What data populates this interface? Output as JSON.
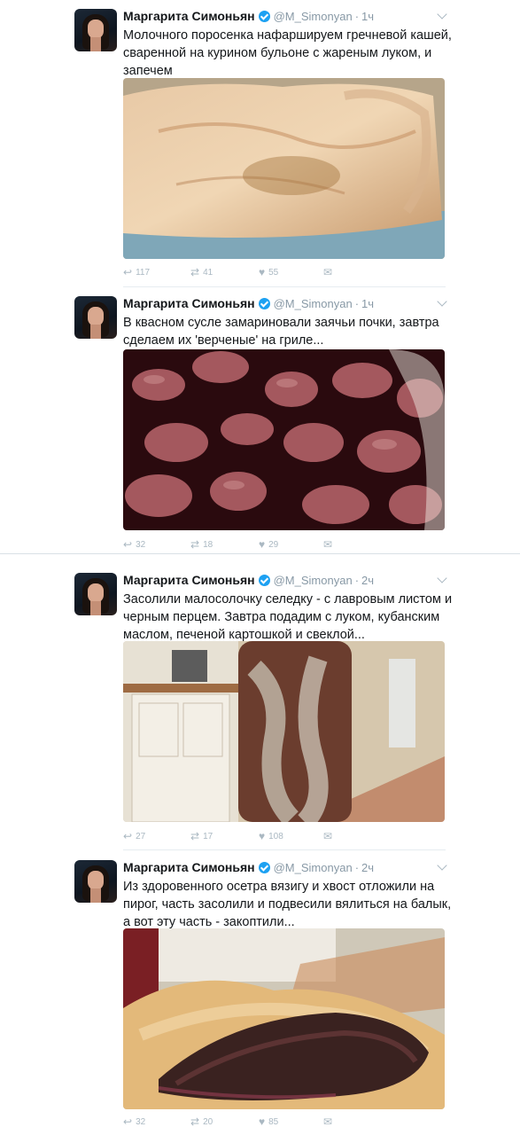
{
  "author": {
    "name": "Маргарита Симоньян",
    "handle": "@M_Simonyan"
  },
  "tweets": [
    {
      "time": "1ч",
      "text": "Молочного поросенка нафаршируем гречневой кашей, сваренной на курином бульоне с жареным луком, и запечем",
      "replies": "117",
      "retweets": "41",
      "likes": "55",
      "media": "roast-piglet-photo"
    },
    {
      "time": "1ч",
      "text": "В квасном сусле замариновали заячьи почки, завтра сделаем их 'верченые' на гриле...",
      "replies": "32",
      "retweets": "18",
      "likes": "29",
      "media": "marinated-kidneys-photo"
    },
    {
      "time": "2ч",
      "text": "Засолили малосолочку селедку - с лавровым листом и черным перцем. Завтра подадим с луком, кубанским маслом, печеной картошкой и свеклой...",
      "replies": "27",
      "retweets": "17",
      "likes": "108",
      "media": "herring-jar-photo"
    },
    {
      "time": "2ч",
      "text": "Из здоровенного осетра вязигу и хвост отложили на пирог, часть засолили и подвесили вялиться на балык, а вот эту часть - закоптили...",
      "replies": "32",
      "retweets": "20",
      "likes": "85",
      "media": "smoked-sturgeon-photo"
    }
  ],
  "icons": {
    "reply": "reply-icon",
    "retweet": "retweet-icon",
    "like": "heart-icon",
    "dm": "direct-message-icon",
    "more": "chevron-down-icon",
    "verified": "verified-badge-icon"
  },
  "colors": {
    "accent": "#1da1f2",
    "muted": "#8899a6",
    "text": "#14171a"
  }
}
